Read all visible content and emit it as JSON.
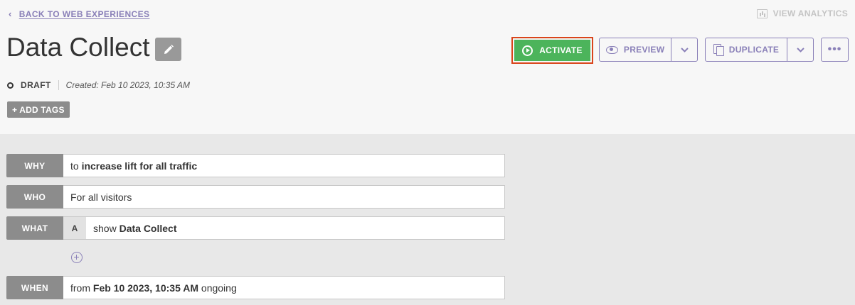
{
  "header": {
    "back_label": "BACK TO WEB EXPERIENCES",
    "view_analytics_label": "VIEW ANALYTICS",
    "title": "Data Collect",
    "activate_label": "ACTIVATE",
    "preview_label": "PREVIEW",
    "duplicate_label": "DUPLICATE",
    "more_label": "•••",
    "status": "DRAFT",
    "created": "Created: Feb 10 2023, 10:35 AM",
    "add_tags_label": "+ ADD TAGS"
  },
  "rules": {
    "why": {
      "tag": "WHY",
      "prefix": "to ",
      "value": "increase lift for all traffic"
    },
    "who": {
      "tag": "WHO",
      "value": "For all visitors"
    },
    "what": {
      "tag": "WHAT",
      "variant": "A",
      "prefix": "show ",
      "value": "Data Collect"
    },
    "when": {
      "tag": "WHEN",
      "prefix": "from ",
      "value": "Feb 10 2023, 10:35 AM",
      "suffix": " ongoing"
    }
  },
  "colors": {
    "accent": "#8a80b8",
    "activate": "#4cb45b",
    "highlight_border": "#d9451b",
    "tag_bg": "#8c8c8c"
  },
  "icons": [
    "chevron-left-icon",
    "analytics-icon",
    "pencil-icon",
    "play-circle-icon",
    "eye-icon",
    "chevron-down-icon",
    "copy-icon",
    "ellipsis-icon",
    "add-circle-icon"
  ]
}
